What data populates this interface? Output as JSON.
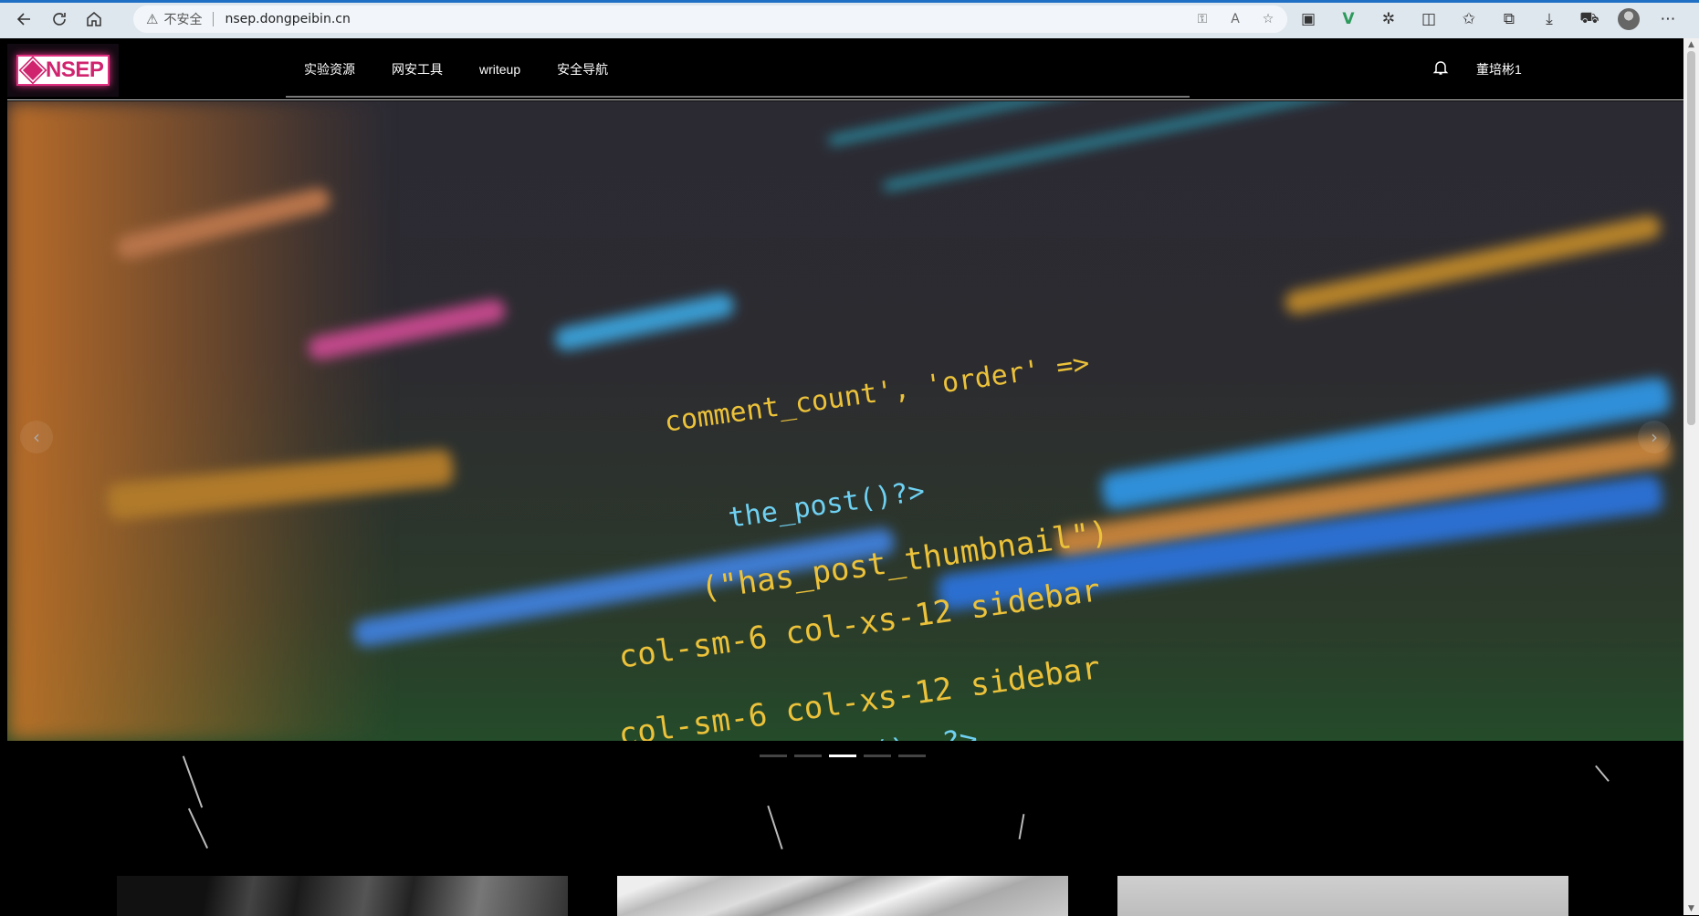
{
  "browser": {
    "insecure_label": "不安全",
    "url": "nsep.dongpeibin.cn"
  },
  "site": {
    "logo_text": "NSEP",
    "nav": [
      "实验资源",
      "网安工具",
      "writeup",
      "安全导航"
    ],
    "username": "董培彬1"
  },
  "hero": {
    "code_lines": [
      {
        "text": "comment_count', 'order' =>",
        "color": "yellow"
      },
      {
        "text": "the_post()?>",
        "color": "cyan"
      },
      {
        "text": "(\"has_post_thumbnail\")",
        "color": "yellow"
      },
      {
        "text": "col-sm-6 col-xs-12 sidebar",
        "color": "yellow"
      },
      {
        "text": "col-sm-6 col-xs-12 sidebar",
        "color": "yellow"
      },
      {
        "text": "the_permalink(); ?>",
        "color": "cyan"
      }
    ],
    "slide_count": 5,
    "active_slide": 3
  },
  "colors": {
    "brand": "#d0246f",
    "chrome": "#dfe7ee",
    "page_bg": "#000000"
  }
}
